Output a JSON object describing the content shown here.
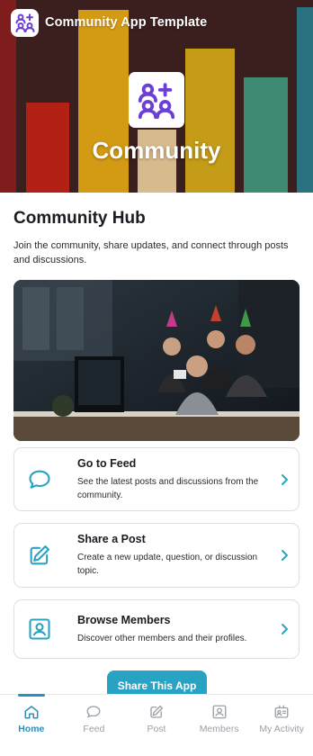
{
  "app": {
    "title": "Community App Template",
    "icon": "community-group-icon"
  },
  "hero": {
    "title": "Community",
    "icon": "community-group-icon",
    "bar_colors": [
      "#8a1f1c",
      "#b32015",
      "#d79b14",
      "#d8b98b",
      "#c49d16",
      "#3f8a72",
      "#2d6f7a"
    ]
  },
  "hub": {
    "title": "Community Hub",
    "description": "Join the community, share updates, and connect through posts and discussions."
  },
  "photo": {
    "icon": "team-celebration-photo"
  },
  "cards": [
    {
      "title": "Go to Feed",
      "description": "See the latest posts and discussions from the community.",
      "icon": "chat-bubble-icon"
    },
    {
      "title": "Share a Post",
      "description": "Create a new update, question, or discussion topic.",
      "icon": "edit-pencil-icon"
    },
    {
      "title": "Browse Members",
      "description": "Discover other members and their profiles.",
      "icon": "member-profile-icon"
    }
  ],
  "share_button": {
    "label": "Share This App"
  },
  "nav": [
    {
      "label": "Home",
      "icon": "home-icon",
      "active": true
    },
    {
      "label": "Feed",
      "icon": "chat-bubble-icon",
      "active": false
    },
    {
      "label": "Post",
      "icon": "edit-pencil-icon",
      "active": false
    },
    {
      "label": "Members",
      "icon": "member-profile-icon",
      "active": false
    },
    {
      "label": "My Activity",
      "icon": "id-card-icon",
      "active": false
    }
  ],
  "colors": {
    "accent": "#29a3c4",
    "brand_purple": "#6b3fd4",
    "nav_active": "#2b8fbd",
    "nav_inactive": "#9aa0a6"
  }
}
